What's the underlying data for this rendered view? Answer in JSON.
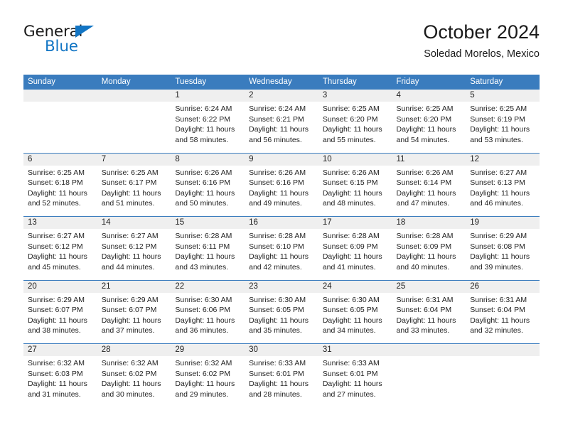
{
  "brand": {
    "name_top": "General",
    "name_bottom": "Blue",
    "accent_color": "#1275c4"
  },
  "header": {
    "title": "October 2024",
    "subtitle": "Soledad Morelos, Mexico"
  },
  "theme": {
    "header_row_color": "#3a7cbe",
    "daynum_band_color": "#efefef",
    "text_color": "#222222"
  },
  "weekday_headers": [
    "Sunday",
    "Monday",
    "Tuesday",
    "Wednesday",
    "Thursday",
    "Friday",
    "Saturday"
  ],
  "weeks": [
    [
      {
        "day": "",
        "lines": []
      },
      {
        "day": "",
        "lines": []
      },
      {
        "day": "1",
        "lines": [
          "Sunrise: 6:24 AM",
          "Sunset: 6:22 PM",
          "Daylight: 11 hours",
          "and 58 minutes."
        ]
      },
      {
        "day": "2",
        "lines": [
          "Sunrise: 6:24 AM",
          "Sunset: 6:21 PM",
          "Daylight: 11 hours",
          "and 56 minutes."
        ]
      },
      {
        "day": "3",
        "lines": [
          "Sunrise: 6:25 AM",
          "Sunset: 6:20 PM",
          "Daylight: 11 hours",
          "and 55 minutes."
        ]
      },
      {
        "day": "4",
        "lines": [
          "Sunrise: 6:25 AM",
          "Sunset: 6:20 PM",
          "Daylight: 11 hours",
          "and 54 minutes."
        ]
      },
      {
        "day": "5",
        "lines": [
          "Sunrise: 6:25 AM",
          "Sunset: 6:19 PM",
          "Daylight: 11 hours",
          "and 53 minutes."
        ]
      }
    ],
    [
      {
        "day": "6",
        "lines": [
          "Sunrise: 6:25 AM",
          "Sunset: 6:18 PM",
          "Daylight: 11 hours",
          "and 52 minutes."
        ]
      },
      {
        "day": "7",
        "lines": [
          "Sunrise: 6:25 AM",
          "Sunset: 6:17 PM",
          "Daylight: 11 hours",
          "and 51 minutes."
        ]
      },
      {
        "day": "8",
        "lines": [
          "Sunrise: 6:26 AM",
          "Sunset: 6:16 PM",
          "Daylight: 11 hours",
          "and 50 minutes."
        ]
      },
      {
        "day": "9",
        "lines": [
          "Sunrise: 6:26 AM",
          "Sunset: 6:16 PM",
          "Daylight: 11 hours",
          "and 49 minutes."
        ]
      },
      {
        "day": "10",
        "lines": [
          "Sunrise: 6:26 AM",
          "Sunset: 6:15 PM",
          "Daylight: 11 hours",
          "and 48 minutes."
        ]
      },
      {
        "day": "11",
        "lines": [
          "Sunrise: 6:26 AM",
          "Sunset: 6:14 PM",
          "Daylight: 11 hours",
          "and 47 minutes."
        ]
      },
      {
        "day": "12",
        "lines": [
          "Sunrise: 6:27 AM",
          "Sunset: 6:13 PM",
          "Daylight: 11 hours",
          "and 46 minutes."
        ]
      }
    ],
    [
      {
        "day": "13",
        "lines": [
          "Sunrise: 6:27 AM",
          "Sunset: 6:12 PM",
          "Daylight: 11 hours",
          "and 45 minutes."
        ]
      },
      {
        "day": "14",
        "lines": [
          "Sunrise: 6:27 AM",
          "Sunset: 6:12 PM",
          "Daylight: 11 hours",
          "and 44 minutes."
        ]
      },
      {
        "day": "15",
        "lines": [
          "Sunrise: 6:28 AM",
          "Sunset: 6:11 PM",
          "Daylight: 11 hours",
          "and 43 minutes."
        ]
      },
      {
        "day": "16",
        "lines": [
          "Sunrise: 6:28 AM",
          "Sunset: 6:10 PM",
          "Daylight: 11 hours",
          "and 42 minutes."
        ]
      },
      {
        "day": "17",
        "lines": [
          "Sunrise: 6:28 AM",
          "Sunset: 6:09 PM",
          "Daylight: 11 hours",
          "and 41 minutes."
        ]
      },
      {
        "day": "18",
        "lines": [
          "Sunrise: 6:28 AM",
          "Sunset: 6:09 PM",
          "Daylight: 11 hours",
          "and 40 minutes."
        ]
      },
      {
        "day": "19",
        "lines": [
          "Sunrise: 6:29 AM",
          "Sunset: 6:08 PM",
          "Daylight: 11 hours",
          "and 39 minutes."
        ]
      }
    ],
    [
      {
        "day": "20",
        "lines": [
          "Sunrise: 6:29 AM",
          "Sunset: 6:07 PM",
          "Daylight: 11 hours",
          "and 38 minutes."
        ]
      },
      {
        "day": "21",
        "lines": [
          "Sunrise: 6:29 AM",
          "Sunset: 6:07 PM",
          "Daylight: 11 hours",
          "and 37 minutes."
        ]
      },
      {
        "day": "22",
        "lines": [
          "Sunrise: 6:30 AM",
          "Sunset: 6:06 PM",
          "Daylight: 11 hours",
          "and 36 minutes."
        ]
      },
      {
        "day": "23",
        "lines": [
          "Sunrise: 6:30 AM",
          "Sunset: 6:05 PM",
          "Daylight: 11 hours",
          "and 35 minutes."
        ]
      },
      {
        "day": "24",
        "lines": [
          "Sunrise: 6:30 AM",
          "Sunset: 6:05 PM",
          "Daylight: 11 hours",
          "and 34 minutes."
        ]
      },
      {
        "day": "25",
        "lines": [
          "Sunrise: 6:31 AM",
          "Sunset: 6:04 PM",
          "Daylight: 11 hours",
          "and 33 minutes."
        ]
      },
      {
        "day": "26",
        "lines": [
          "Sunrise: 6:31 AM",
          "Sunset: 6:04 PM",
          "Daylight: 11 hours",
          "and 32 minutes."
        ]
      }
    ],
    [
      {
        "day": "27",
        "lines": [
          "Sunrise: 6:32 AM",
          "Sunset: 6:03 PM",
          "Daylight: 11 hours",
          "and 31 minutes."
        ]
      },
      {
        "day": "28",
        "lines": [
          "Sunrise: 6:32 AM",
          "Sunset: 6:02 PM",
          "Daylight: 11 hours",
          "and 30 minutes."
        ]
      },
      {
        "day": "29",
        "lines": [
          "Sunrise: 6:32 AM",
          "Sunset: 6:02 PM",
          "Daylight: 11 hours",
          "and 29 minutes."
        ]
      },
      {
        "day": "30",
        "lines": [
          "Sunrise: 6:33 AM",
          "Sunset: 6:01 PM",
          "Daylight: 11 hours",
          "and 28 minutes."
        ]
      },
      {
        "day": "31",
        "lines": [
          "Sunrise: 6:33 AM",
          "Sunset: 6:01 PM",
          "Daylight: 11 hours",
          "and 27 minutes."
        ]
      },
      {
        "day": "",
        "lines": []
      },
      {
        "day": "",
        "lines": []
      }
    ]
  ]
}
